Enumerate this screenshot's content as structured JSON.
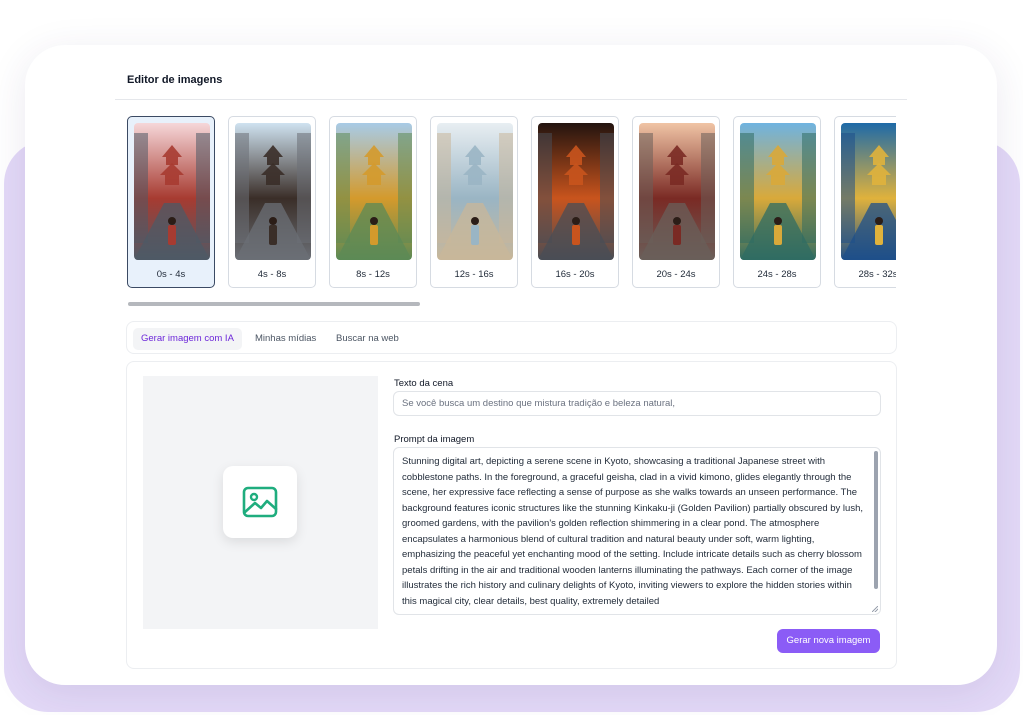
{
  "editor": {
    "title": "Editor de imagens"
  },
  "thumbnails": [
    {
      "label": "0s - 4s",
      "selected": true,
      "scene": "street-pagoda-geisha",
      "palette": [
        "#f6d7d9",
        "#a73b31",
        "#4e5a66"
      ]
    },
    {
      "label": "4s - 8s",
      "selected": false,
      "scene": "street-pagoda-lanterns",
      "palette": [
        "#cfe2f0",
        "#3a2e28",
        "#6b6f76"
      ]
    },
    {
      "label": "8s - 12s",
      "selected": false,
      "scene": "golden-pagoda-garden",
      "palette": [
        "#a8cbe6",
        "#d49a2c",
        "#5c8a56"
      ]
    },
    {
      "label": "12s - 16s",
      "selected": false,
      "scene": "misty-pagoda-path",
      "palette": [
        "#e8eef2",
        "#9ab5c4",
        "#c8b79a"
      ]
    },
    {
      "label": "16s - 20s",
      "selected": false,
      "scene": "night-lantern-alley",
      "palette": [
        "#23140f",
        "#c9541d",
        "#494d55"
      ]
    },
    {
      "label": "20s - 24s",
      "selected": false,
      "scene": "sunset-alley-geisha",
      "palette": [
        "#f0c4a5",
        "#7a2a24",
        "#6a5f5a"
      ]
    },
    {
      "label": "24s - 28s",
      "selected": false,
      "scene": "golden-pavilion-reflection",
      "palette": [
        "#6fb3e0",
        "#d9a93a",
        "#2f6c63"
      ]
    },
    {
      "label": "28s - 32s",
      "selected": false,
      "scene": "golden-pavilion-blossoms",
      "palette": [
        "#1e6aa8",
        "#e0b23c",
        "#1e4f8a"
      ]
    }
  ],
  "tabs": [
    {
      "label": "Gerar imagem com IA",
      "active": true
    },
    {
      "label": "Minhas mídias",
      "active": false
    },
    {
      "label": "Buscar na web",
      "active": false
    }
  ],
  "form": {
    "scene_text_label": "Texto da cena",
    "scene_text_value": "Se você busca um destino que mistura tradição e beleza natural,",
    "prompt_label": "Prompt da imagem",
    "prompt_value": "Stunning digital art, depicting a serene scene in Kyoto, showcasing a traditional Japanese street with cobblestone paths. In the foreground, a graceful geisha, clad in a vivid kimono, glides elegantly through the scene, her expressive face reflecting a sense of purpose as she walks towards an unseen performance. The background features iconic structures like the stunning Kinkaku-ji (Golden Pavilion) partially obscured by lush, groomed gardens, with the pavilion's golden reflection shimmering in a clear pond. The atmosphere encapsulates a harmonious blend of cultural tradition and natural beauty under soft, warm lighting, emphasizing the peaceful yet enchanting mood of the setting. Include intricate details such as cherry blossom petals drifting in the air and traditional wooden lanterns illuminating the pathways. Each corner of the image illustrates the rich history and culinary delights of Kyoto, inviting viewers to explore the hidden stories within this magical city, clear details, best quality, extremely detailed",
    "generate_button": "Gerar nova imagem"
  },
  "image_placeholder_icon": "image-icon",
  "colors": {
    "accent": "#8b5cf6",
    "active_tab_text": "#6d28d9",
    "selected_thumb_bg": "#e8f1fb",
    "icon_green": "#1fad7e",
    "backdrop_purple": "#e3d9f7"
  }
}
